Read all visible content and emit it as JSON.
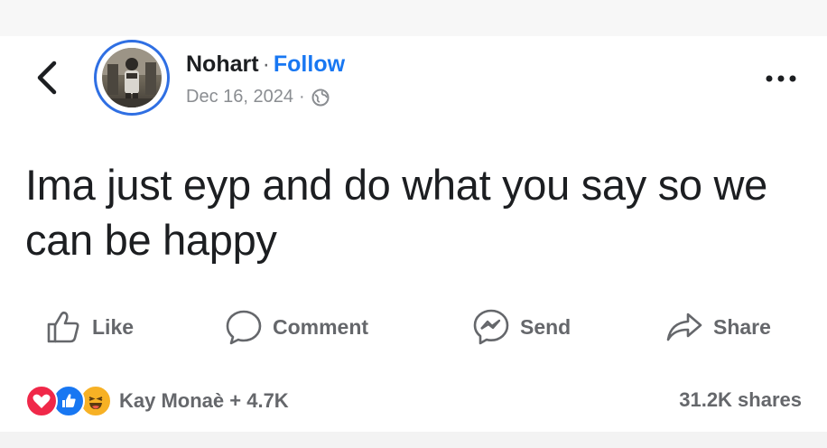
{
  "post": {
    "author": "Nohart",
    "separator": "·",
    "follow_label": "Follow",
    "date": "Dec 16, 2024",
    "meta_dot": "·",
    "privacy_icon": "globe-icon",
    "text": "Ima just eyp and do what you say so we can be happy"
  },
  "actions": {
    "like_label": "Like",
    "comment_label": "Comment",
    "send_label": "Send",
    "share_label": "Share"
  },
  "engagement": {
    "reaction_icons": [
      "love",
      "like",
      "haha"
    ],
    "reaction_summary": "Kay Monaè + 4.7K",
    "shares": "31.2K shares"
  },
  "colors": {
    "link": "#1877f2",
    "avatar_ring": "#2f6fe3",
    "muted": "#65676b",
    "love": "#f02849",
    "like": "#1877f2",
    "haha": "#f7b125"
  }
}
